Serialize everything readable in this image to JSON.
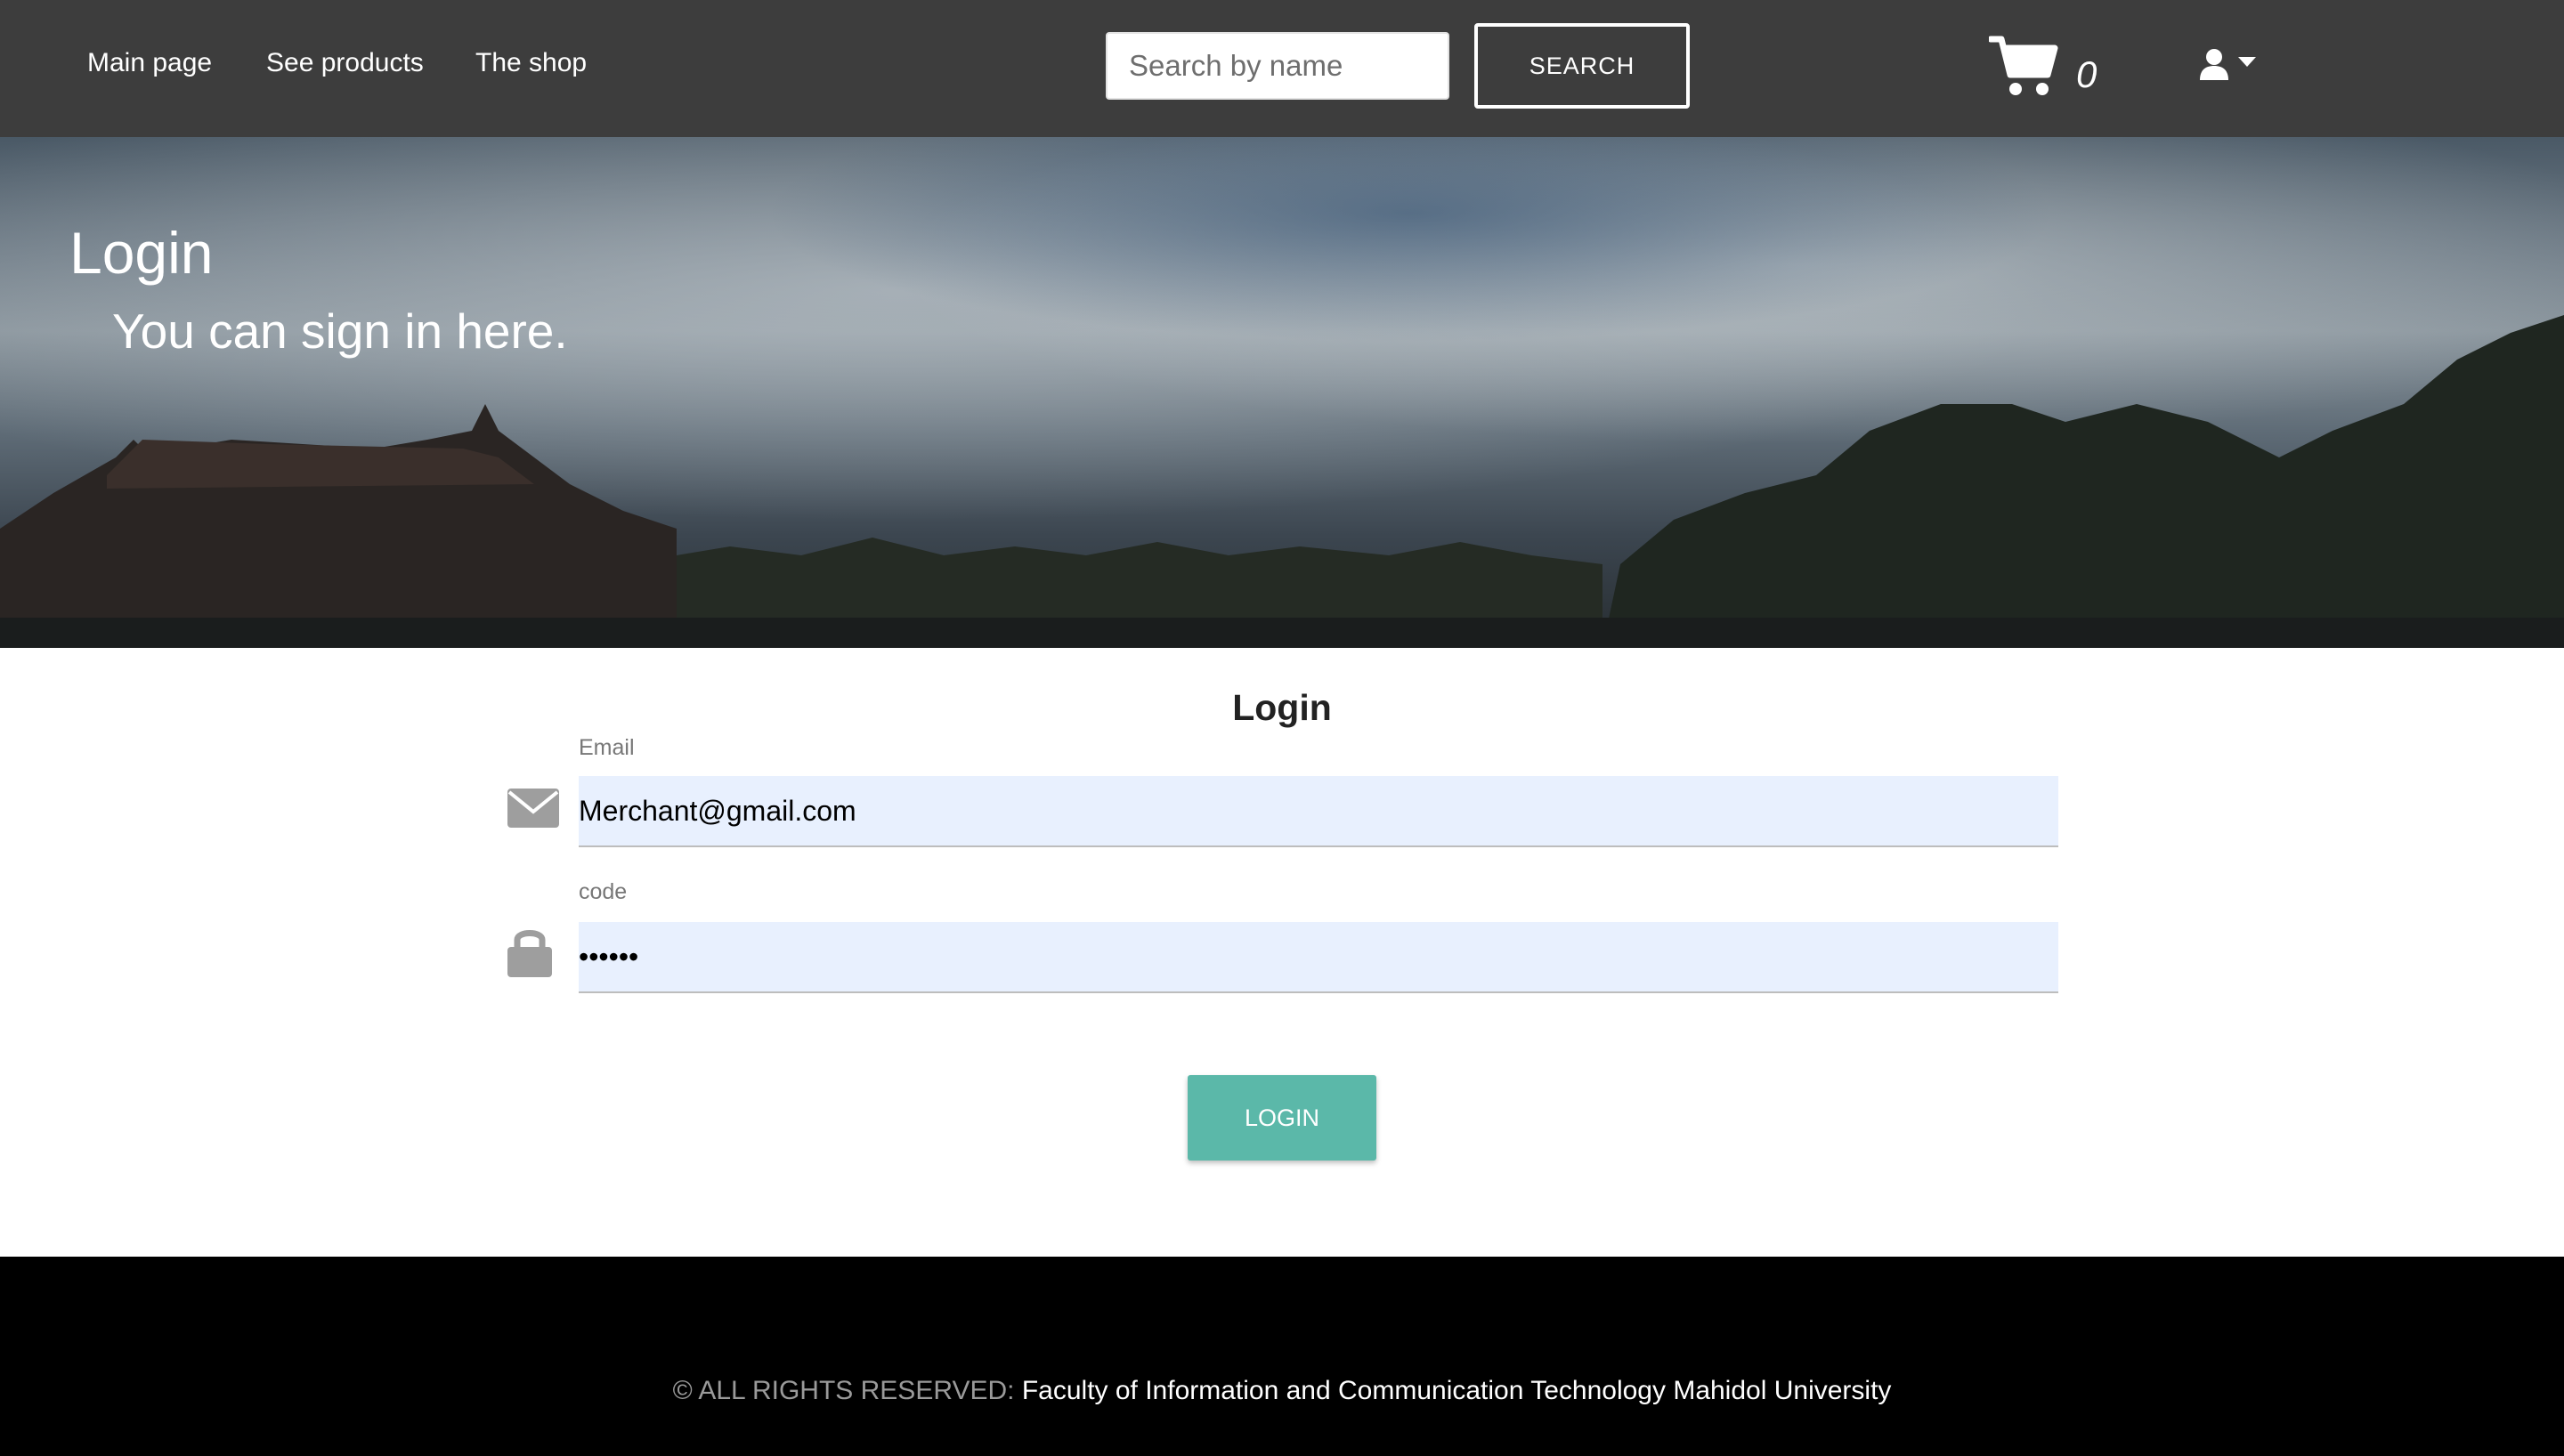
{
  "navbar": {
    "links": [
      "Main page",
      "See products",
      "The shop"
    ],
    "search": {
      "placeholder": "Search by name",
      "value": "",
      "button_label": "SEARCH"
    },
    "cart": {
      "icon": "shopping-cart-icon",
      "count": "0"
    },
    "user": {
      "icon": "user-icon",
      "caret_icon": "caret-down-icon"
    }
  },
  "hero": {
    "title": "Login",
    "subtitle": "You can sign in here."
  },
  "login_form": {
    "heading": "Login",
    "email": {
      "label": "Email",
      "value": "Merchant@gmail.com",
      "icon": "envelope-icon"
    },
    "code": {
      "label": "code",
      "value": "••••••",
      "icon": "lock-icon"
    },
    "submit_label": "LOGIN"
  },
  "footer": {
    "rights": "© ALL RIGHTS RESERVED:",
    "organization": "Faculty of Information and Communication Technology Mahidol University"
  },
  "colors": {
    "navbar_bg": "#3d3d3d",
    "input_bg": "#e8f0fe",
    "accent": "#5bb8a9",
    "footer_bg": "#000000"
  }
}
